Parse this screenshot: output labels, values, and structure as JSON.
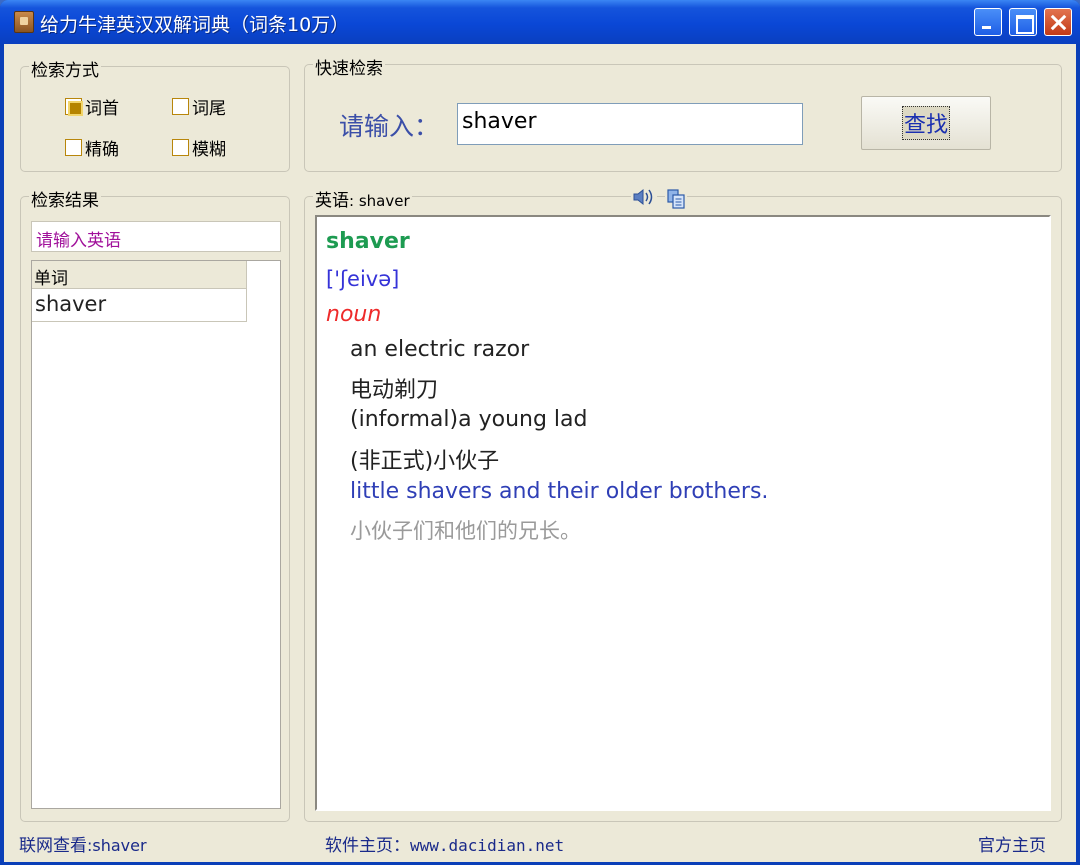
{
  "window": {
    "title": "给力牛津英汉双解词典（词条10万）"
  },
  "search_mode": {
    "legend": "检索方式",
    "options": [
      {
        "label": "词首",
        "checked": true
      },
      {
        "label": "词尾",
        "checked": false
      },
      {
        "label": "精确",
        "checked": false
      },
      {
        "label": "模糊",
        "checked": false
      }
    ]
  },
  "quick_search": {
    "legend": "快速检索",
    "prompt": "请输入：",
    "input_value": "shaver",
    "button_label": "查找"
  },
  "results": {
    "legend": "检索结果",
    "hint": "请输入英语",
    "column_header": "单词",
    "rows": [
      "shaver"
    ]
  },
  "entry": {
    "legend_prefix": "英语",
    "legend_word": ": shaver",
    "headword": "shaver",
    "phonetic": "['ʃeivə]",
    "pos": "noun",
    "definitions": [
      {
        "text": "an electric razor",
        "style": "def"
      },
      {
        "text": "电动剃刀",
        "style": "def"
      },
      {
        "text": "(informal)a young lad",
        "style": "def"
      },
      {
        "text": "(非正式)小伙子",
        "style": "def"
      },
      {
        "text": "little shavers and their older brothers.",
        "style": "ex"
      },
      {
        "text": "小伙子们和他们的兄长。",
        "style": "ex-cn"
      }
    ]
  },
  "statusbar": {
    "online_label": "联网查看",
    "online_word": ":shaver",
    "homepage_label": "软件主页：",
    "homepage_url": "www.dacidian.net",
    "official_label": "官方主页"
  }
}
